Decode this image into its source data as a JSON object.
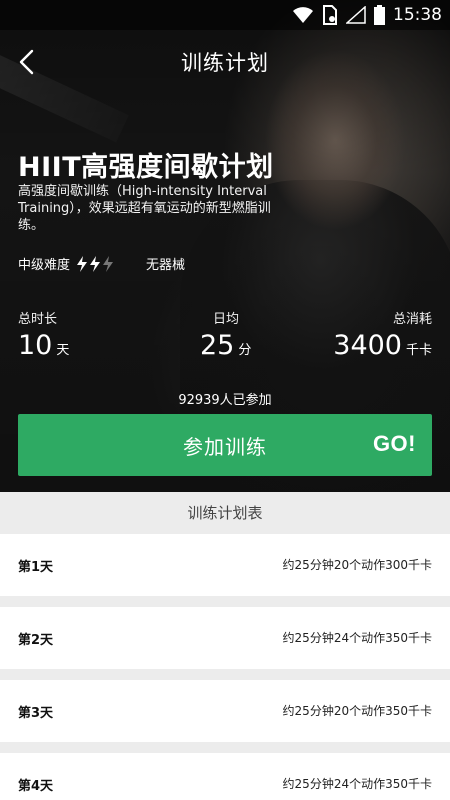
{
  "status_bar": {
    "time": "15:38"
  },
  "header": {
    "title": "训练计划"
  },
  "plan": {
    "name": "HIIT高强度间歇计划",
    "description": "高强度间歇训练（High-intensity Interval Training），效果远超有氧运动的新型燃脂训练。",
    "difficulty_label": "中级难度",
    "difficulty_level": 2,
    "difficulty_max": 3,
    "equipment": "无器械"
  },
  "stats": {
    "duration": {
      "label": "总时长",
      "value": "10",
      "unit": "天"
    },
    "daily": {
      "label": "日均",
      "value": "25",
      "unit": "分"
    },
    "calories": {
      "label": "总消耗",
      "value": "3400",
      "unit": "千卡"
    }
  },
  "participants_text": "92939人已参加",
  "join_button": {
    "label": "参加训练",
    "go": "GO!",
    "color": "#2eaa63"
  },
  "schedule": {
    "title": "训练计划表",
    "days": [
      {
        "name": "第1天",
        "detail": "约25分钟20个动作300千卡"
      },
      {
        "name": "第2天",
        "detail": "约25分钟24个动作350千卡"
      },
      {
        "name": "第3天",
        "detail": "约25分钟20个动作350千卡"
      },
      {
        "name": "第4天",
        "detail": "约25分钟24个动作350千卡"
      }
    ]
  },
  "icons": [
    "wifi-icon",
    "sim-icon",
    "signal-icon",
    "battery-icon",
    "back-arrow-icon",
    "lightning-bolt-icon"
  ]
}
